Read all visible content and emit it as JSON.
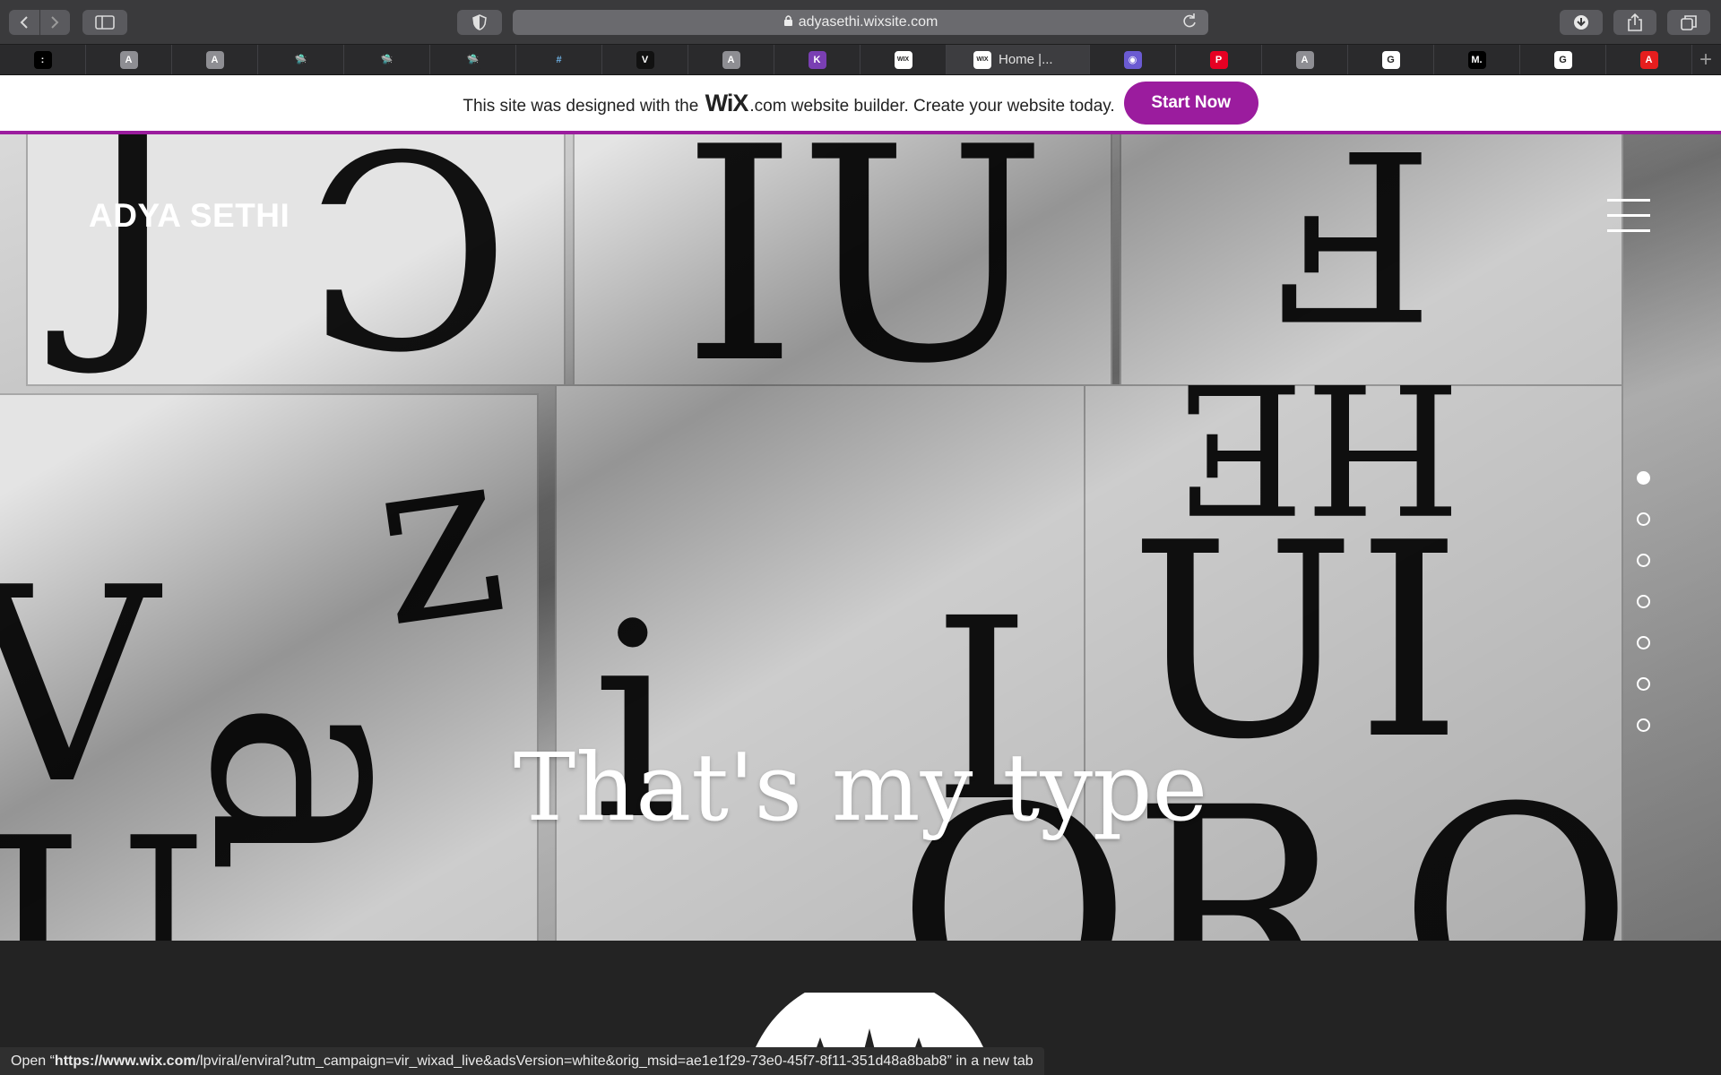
{
  "browser": {
    "url": "adyasethi.wixsite.com",
    "active_tab_title": "Home |...",
    "tabs": [
      {
        "icon": "dots-icon",
        "label": ":",
        "bg": "#000000"
      },
      {
        "icon": "letter-a-icon",
        "label": "A",
        "bg": "#8e8e93"
      },
      {
        "icon": "letter-a-icon",
        "label": "A",
        "bg": "#8e8e93"
      },
      {
        "icon": "ufo-icon",
        "label": "",
        "bg": "#2a2a2c"
      },
      {
        "icon": "ufo-icon",
        "label": "",
        "bg": "#2a2a2c"
      },
      {
        "icon": "ufo-icon",
        "label": "",
        "bg": "#2a2a2c"
      },
      {
        "icon": "hash-icon",
        "label": "",
        "bg": "#2a2a2c"
      },
      {
        "icon": "v-logo-icon",
        "label": "V",
        "bg": "#111111"
      },
      {
        "icon": "letter-a-icon",
        "label": "A",
        "bg": "#8e8e93"
      },
      {
        "icon": "k-logo-icon",
        "label": "K",
        "bg": "#7a3fb3"
      },
      {
        "icon": "wix-icon",
        "label": "WIX",
        "bg": "#ffffff"
      },
      {
        "icon": "wix-icon",
        "label": "WIX",
        "bg": "#ffffff",
        "active": true
      },
      {
        "icon": "globe-icon",
        "label": "",
        "bg": "#6b5bd2"
      },
      {
        "icon": "pinterest-icon",
        "label": "P",
        "bg": "#e60023"
      },
      {
        "icon": "letter-a-icon",
        "label": "A",
        "bg": "#8e8e93"
      },
      {
        "icon": "google-icon",
        "label": "G",
        "bg": "#ffffff"
      },
      {
        "icon": "medium-icon",
        "label": "M.",
        "bg": "#000000"
      },
      {
        "icon": "google-icon",
        "label": "G",
        "bg": "#ffffff"
      },
      {
        "icon": "adobe-icon",
        "label": "A",
        "bg": "#e61e1e"
      }
    ]
  },
  "wix_banner": {
    "text_before": "This site was designed with the ",
    "logo": "WiX",
    "text_after": ".com website builder. Create your website today.",
    "cta": "Start Now",
    "accent": "#9b1c9e"
  },
  "site": {
    "title": "ADYA SETHI",
    "tagline": "That's my type",
    "nav_dots": 7,
    "active_dot": 0
  },
  "status_bar": {
    "prefix": "Open “",
    "host": "https://www.wix.com",
    "path": "/lpviral/enviral?utm_campaign=vir_wixad_live&adsVersion=white&orig_msid=ae1e1f29-73e0-45f7-8f11-351d48a8bab8",
    "suffix": "” in a new tab"
  }
}
